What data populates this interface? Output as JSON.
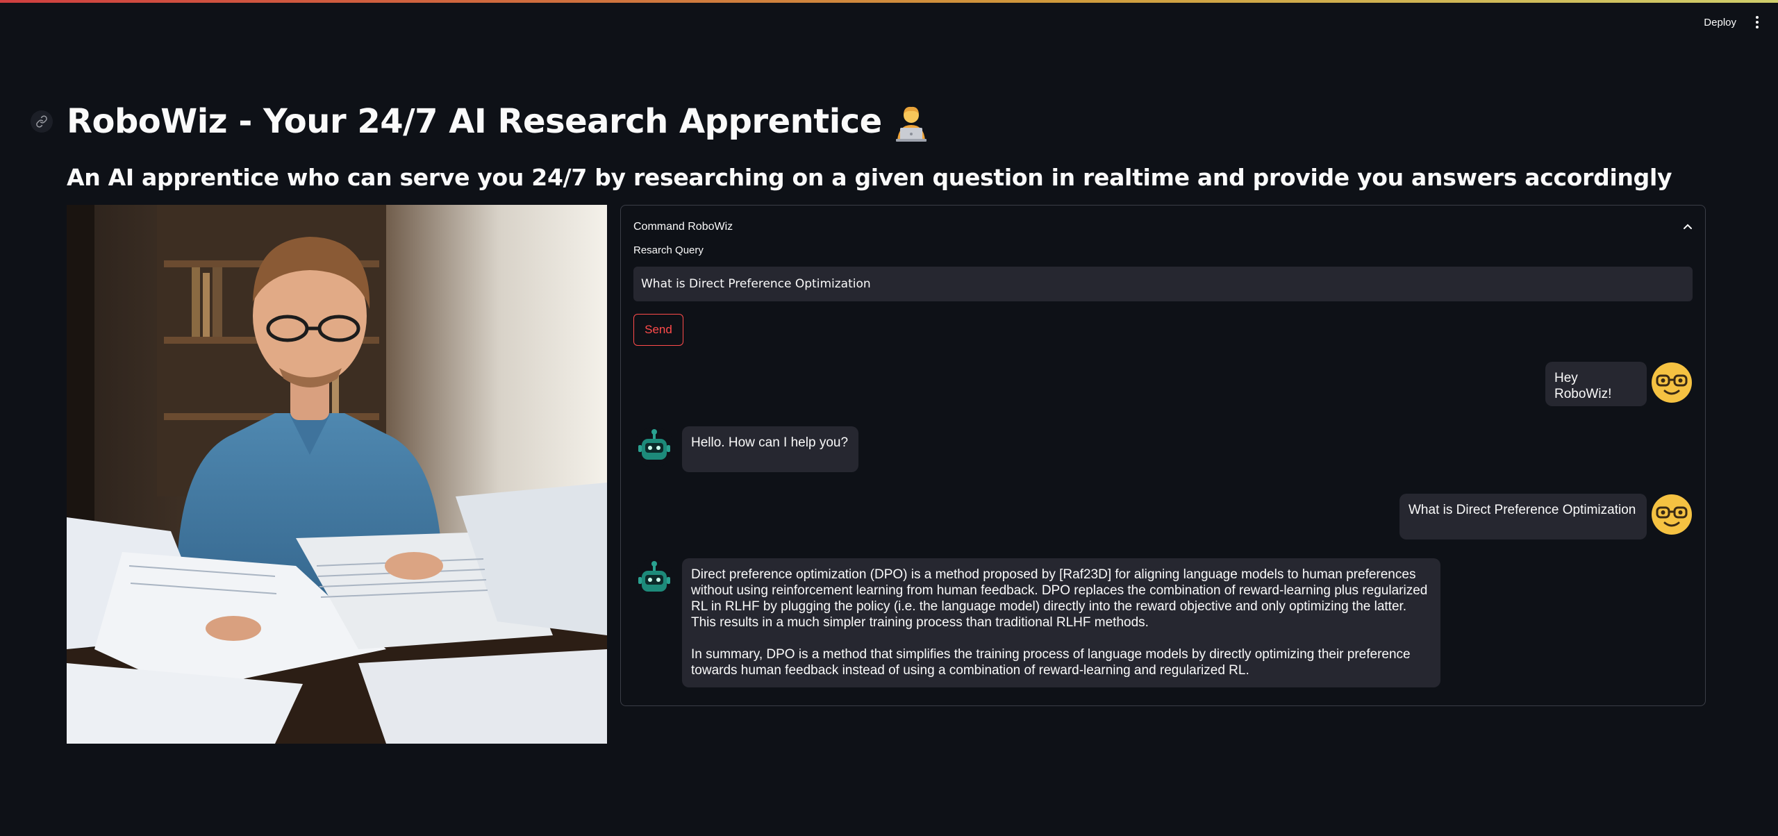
{
  "header": {
    "deploy_label": "Deploy",
    "menu_icon": "more-vertical-icon"
  },
  "page": {
    "title": "RoboWiz - Your 24/7 AI Research Apprentice",
    "title_emoji_icon": "technologist-emoji-icon",
    "subtitle": "An AI apprentice who can serve you 24/7 by researching on a given question in realtime and provide you answers accordingly"
  },
  "hero_image": {
    "icon": "researcher-photo"
  },
  "expander": {
    "title": "Command RoboWiz",
    "query_label": "Resarch Query",
    "query_value": "What is Direct Preference Optimization",
    "send_label": "Send"
  },
  "messages": [
    {
      "role": "user",
      "text": "Hey RoboWiz!"
    },
    {
      "role": "bot",
      "text": "Hello. How can I help you?"
    },
    {
      "role": "user",
      "text": "What is Direct Preference Optimization"
    },
    {
      "role": "bot",
      "paragraph1": "Direct preference optimization (DPO) is a method proposed by [Raf23D] for aligning language models to human preferences without using reinforcement learning from human feedback. DPO replaces the combination of reward-learning plus regularized RL in RLHF by plugging the policy (i.e. the language model) directly into the reward objective and only optimizing the latter. This results in a much simpler training process than traditional RLHF methods.",
      "paragraph2": "In summary, DPO is a method that simplifies the training process of language models by directly optimizing their preference towards human feedback instead of using a combination of reward-learning and regularized RL."
    }
  ],
  "colors": {
    "background": "#0e1117",
    "accent": "#ff4b4b",
    "bubble": "#262730"
  }
}
